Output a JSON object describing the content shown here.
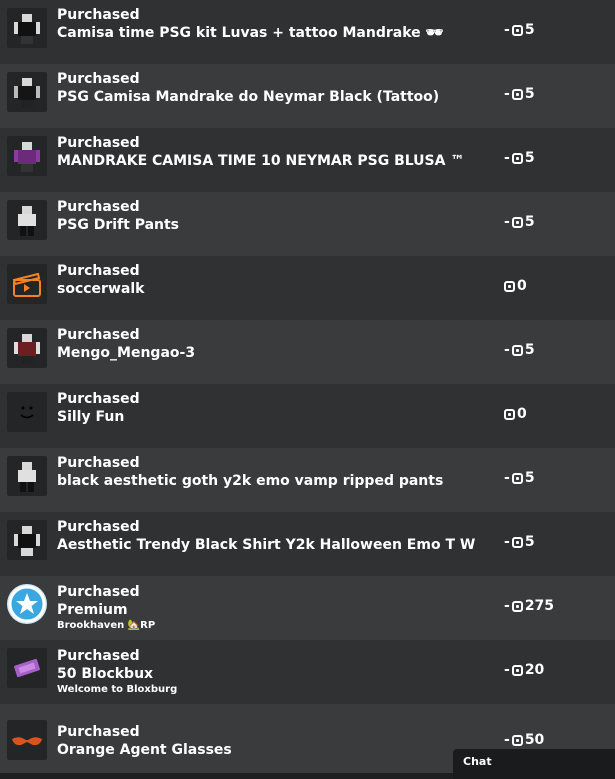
{
  "transactions": [
    {
      "status": "Purchased",
      "name": "Camisa time PSG kit Luvas + tattoo Mandrake 🕶",
      "place": "",
      "price": "-5",
      "thumb": "black-shirt-thumbnail"
    },
    {
      "status": "Purchased",
      "name": "PSG Camisa Mandrake do Neymar Black (Tattoo)",
      "place": "",
      "price": "-5",
      "thumb": "black-shirt-thumbnail"
    },
    {
      "status": "Purchased",
      "name": "MANDRAKE CAMISA TIME 10 NEYMAR PSG BLUSA ™",
      "place": "",
      "price": "-5",
      "thumb": "purple-shirt-thumbnail"
    },
    {
      "status": "Purchased",
      "name": "PSG Drift Pants",
      "place": "",
      "price": "-5",
      "thumb": "pants-thumbnail"
    },
    {
      "status": "Purchased",
      "name": "soccerwalk",
      "place": "",
      "price": "0",
      "thumb": "animation-clapperboard-icon"
    },
    {
      "status": "Purchased",
      "name": "Mengo_Mengao-3",
      "place": "",
      "price": "-5",
      "thumb": "red-shirt-thumbnail"
    },
    {
      "status": "Purchased",
      "name": "Silly Fun",
      "place": "",
      "price": "0",
      "thumb": "face-thumbnail"
    },
    {
      "status": "Purchased",
      "name": "black aesthetic goth y2k emo vamp ripped pants",
      "place": "",
      "price": "-5",
      "thumb": "pants-thumbnail"
    },
    {
      "status": "Purchased",
      "name": "Aesthetic Trendy Black Shirt Y2k Halloween Emo T W",
      "place": "",
      "price": "-5",
      "thumb": "black-shirt-thumbnail"
    },
    {
      "status": "Purchased",
      "name": "Premium",
      "place": "Brookhaven 🏡RP",
      "price": "-275",
      "thumb": "premium-star-badge"
    },
    {
      "status": "Purchased",
      "name": "50 Blockbux",
      "place": "Welcome to Bloxburg",
      "price": "-20",
      "thumb": "blockbux-ticket"
    },
    {
      "status": "Purchased",
      "name": "Orange Agent Glasses",
      "place": "",
      "price": "-50",
      "thumb": "orange-glasses-thumbnail"
    }
  ],
  "chat": {
    "label": "Chat"
  },
  "colors": {
    "row_odd": "#393b3d",
    "row_even": "#2f3133",
    "background": "#232527"
  }
}
